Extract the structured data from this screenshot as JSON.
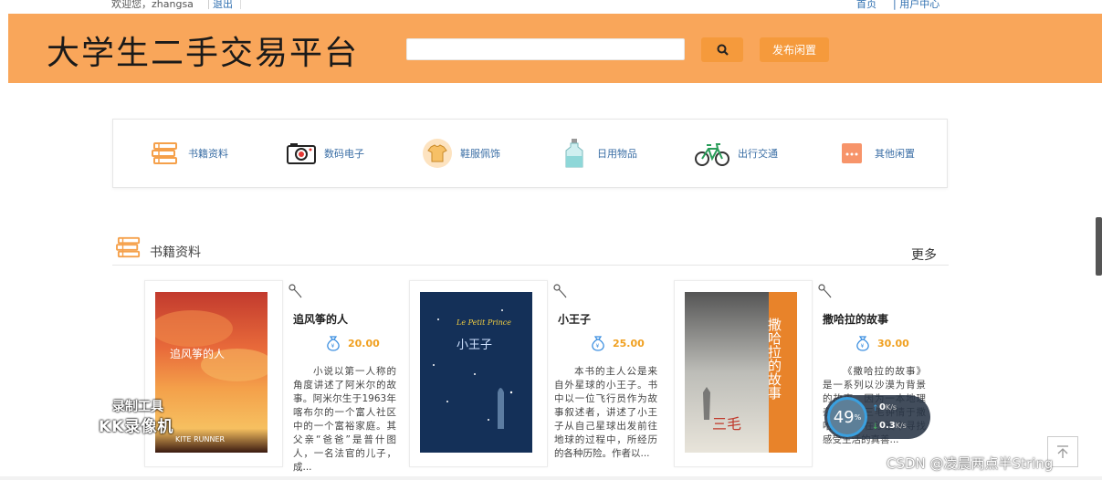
{
  "topbar": {
    "welcome": "欢迎您，zhangsa",
    "logout": "退出",
    "home": "首页",
    "user_center": "| 用户中心"
  },
  "header": {
    "title": "大学生二手交易平台",
    "search_placeholder": "",
    "search_icon": "search-icon",
    "publish_label": "发布闲置"
  },
  "categories": [
    {
      "label": "书籍资料",
      "icon": "book-stack-icon"
    },
    {
      "label": "数码电子",
      "icon": "camera-icon"
    },
    {
      "label": "鞋服佩饰",
      "icon": "tshirt-icon"
    },
    {
      "label": "日用物品",
      "icon": "bottle-icon"
    },
    {
      "label": "出行交通",
      "icon": "bicycle-icon"
    },
    {
      "label": "其他闲置",
      "icon": "more-dots-icon"
    }
  ],
  "section": {
    "title": "书籍资料",
    "more": "更多"
  },
  "books": [
    {
      "title": "追风筝的人",
      "price": "20.00",
      "cover_text": "追风筝的人",
      "cover_sub": "KITE RUNNER",
      "desc": "小说以第一人称的角度讲述了阿米尔的故事。阿米尔生于1963年喀布尔的一个富人社区中的一个富裕家庭。其父亲“爸爸”是普什图人，一名法官的儿子，成..."
    },
    {
      "title": "小王子",
      "price": "25.00",
      "cover_text": "小王子",
      "cover_sub": "Le Petit Prince",
      "desc": "本书的主人公是来自外星球的小王子。书中以一位飞行员作为故事叙述者，讲述了小王子从自己星球出发前往地球的过程中，所经历的各种历险。作者以..."
    },
    {
      "title": "撒哈拉的故事",
      "price": "30.00",
      "cover_text": "撒哈拉的故事",
      "cover_sub": "三毛",
      "desc": "《撒哈拉的故事》是一系列以沙漠为背景的故事，因为一本地理杂志，使三毛钟情于撒哈拉，并在沙漠中寻找感受生活的真善..."
    }
  ],
  "overlay": {
    "recorder_line1": "录制工具",
    "recorder_line2": "KK录像机",
    "percent": "49",
    "percent_unit": "%",
    "up_speed": "0",
    "down_speed": "0.3",
    "speed_unit": "K/s",
    "csdn": "CSDN @凌晨两点半String"
  },
  "colors": {
    "header_bg": "#f9a65a",
    "button_bg": "#f59a3c",
    "price": "#f0a020",
    "link": "#2f6fb0"
  }
}
